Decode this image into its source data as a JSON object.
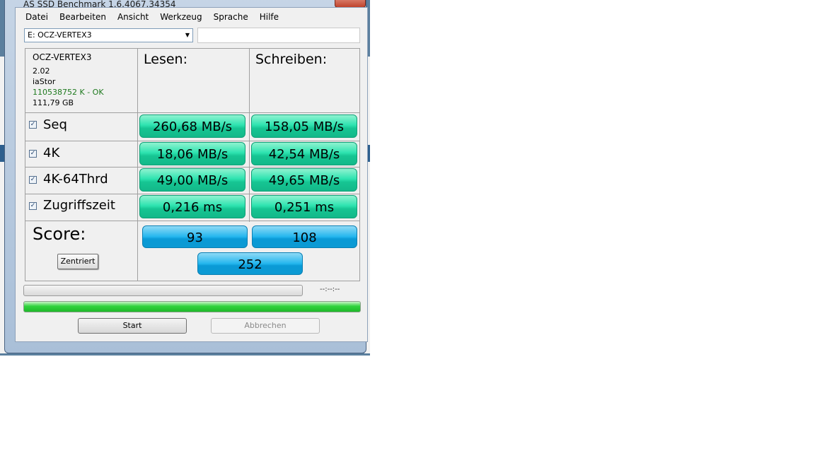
{
  "window": {
    "title": "AS SSD Benchmark 1.6.4067.34354"
  },
  "menu": [
    "Datei",
    "Bearbeiten",
    "Ansicht",
    "Werkzeug",
    "Sprache",
    "Hilfe"
  ],
  "drive": {
    "selected": "E: OCZ-VERTEX3"
  },
  "info": {
    "name": "OCZ-VERTEX3",
    "firmware": "2.02",
    "driver": "iaStor",
    "alignment": "110538752 K - OK",
    "size": "111,79 GB"
  },
  "columns": {
    "read": "Lesen:",
    "write": "Schreiben:"
  },
  "rows": [
    {
      "label": "Seq",
      "checked": true,
      "read": "260,68 MB/s",
      "write": "158,05 MB/s"
    },
    {
      "label": "4K",
      "checked": true,
      "read": "18,06 MB/s",
      "write": "42,54 MB/s"
    },
    {
      "label": "4K-64Thrd",
      "checked": true,
      "read": "49,00 MB/s",
      "write": "49,65 MB/s"
    },
    {
      "label": "Zugriffszeit",
      "checked": true,
      "read": "0,216 ms",
      "write": "0,251 ms"
    }
  ],
  "score": {
    "label": "Score:",
    "read": "93",
    "write": "108",
    "total": "252",
    "center_button": "Zentriert"
  },
  "progress": {
    "time": "--:--:--",
    "test_progress": 0,
    "overall_progress": 1.0
  },
  "buttons": {
    "start": "Start",
    "abort": "Abbrechen"
  },
  "colors": {
    "value_box": "#2ee3b0",
    "score_box": "#23b6ee",
    "progress": "#2fd33c",
    "alignment_ok": "#1f7a1f"
  }
}
